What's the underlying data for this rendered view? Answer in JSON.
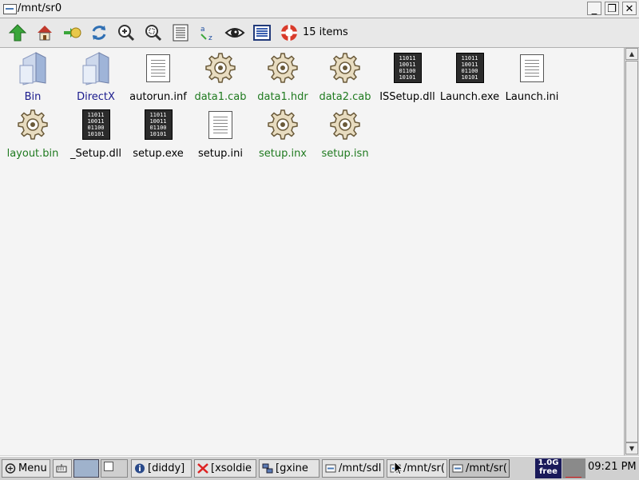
{
  "window": {
    "title": "/mnt/sr0"
  },
  "window_buttons": {
    "minimize": "_",
    "maximize": "❐",
    "close": "✕"
  },
  "toolbar": {
    "buttons": [
      "up-arrow-icon",
      "home-icon",
      "bookmark-icon",
      "refresh-icon",
      "zoom-in-icon",
      "zoom-fit-icon",
      "list-view-icon",
      "sort-az-icon",
      "show-hidden-icon",
      "details-view-icon",
      "help-icon"
    ],
    "item_count": "15 items"
  },
  "files": [
    {
      "name": "Bin",
      "kind": "folder",
      "color": "#1a1a8c"
    },
    {
      "name": "DirectX",
      "kind": "folder",
      "color": "#1a1a8c"
    },
    {
      "name": "autorun.inf",
      "kind": "text"
    },
    {
      "name": "data1.cab",
      "kind": "gear"
    },
    {
      "name": "data1.hdr",
      "kind": "gear"
    },
    {
      "name": "data2.cab",
      "kind": "gear"
    },
    {
      "name": "ISSetup.dll",
      "kind": "binary"
    },
    {
      "name": "Launch.exe",
      "kind": "binary"
    },
    {
      "name": "Launch.ini",
      "kind": "text"
    },
    {
      "name": "layout.bin",
      "kind": "gear"
    },
    {
      "name": "_Setup.dll",
      "kind": "binary"
    },
    {
      "name": "setup.exe",
      "kind": "binary"
    },
    {
      "name": "setup.ini",
      "kind": "text"
    },
    {
      "name": "setup.inx",
      "kind": "gear"
    },
    {
      "name": "setup.isn",
      "kind": "gear"
    }
  ],
  "binary_icon_text": "11011\n10011\n01100\n10101",
  "taskbar": {
    "menu_label": "Menu",
    "tasks": [
      "[diddy]",
      "[xsoldie",
      "[gxine",
      "/mnt/sdl",
      "/mnt/sr(",
      "/mnt/sr("
    ],
    "memory_value": "1.0G",
    "memory_label": "free",
    "clock": "09:21 PM"
  },
  "colors": {
    "folder_text": "#1a1a8c",
    "gear_text": "#1f7a1f",
    "plain_text": "#000000"
  }
}
